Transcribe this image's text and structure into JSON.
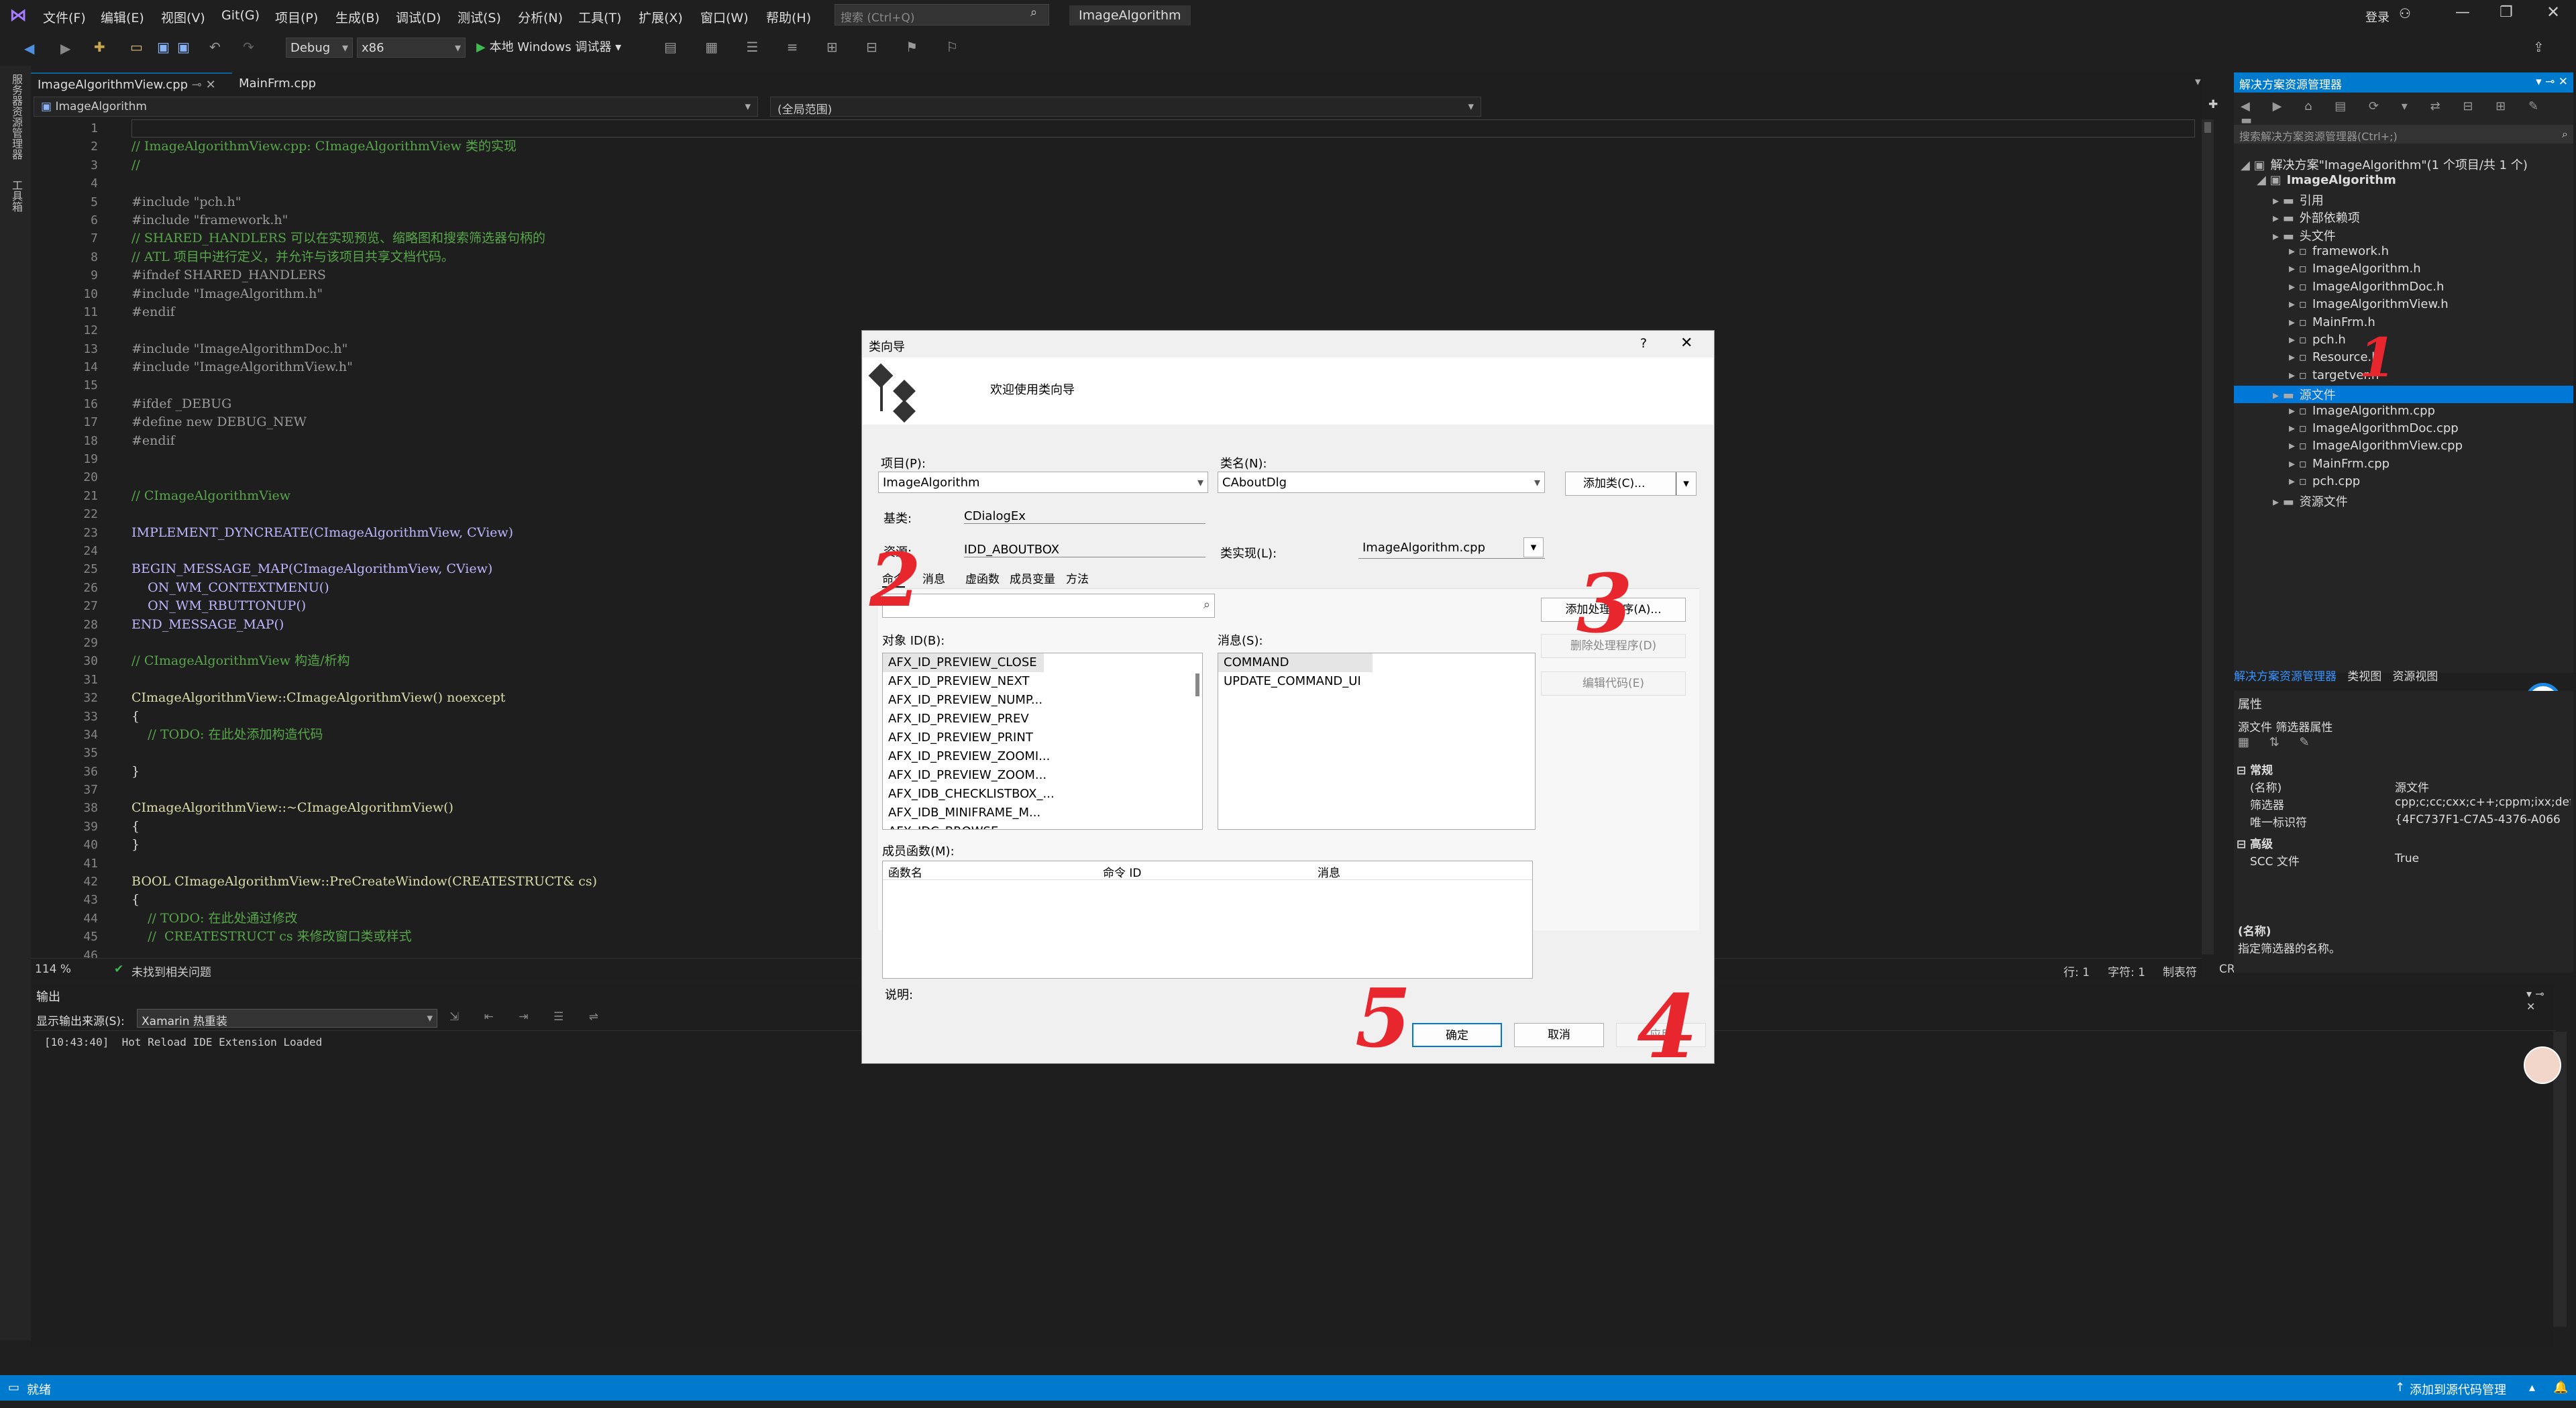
{
  "menu": [
    "文件(F)",
    "编辑(E)",
    "视图(V)",
    "Git(G)",
    "项目(P)",
    "生成(B)",
    "调试(D)",
    "测试(S)",
    "分析(N)",
    "工具(T)",
    "扩展(X)",
    "窗口(W)",
    "帮助(H)"
  ],
  "search": {
    "placeholder": "搜索 (Ctrl+Q)"
  },
  "app_title": "ImageAlgorithm",
  "login": "登录",
  "toolbar": {
    "config": "Debug",
    "platform": "x86",
    "run": "本地 Windows 调试器"
  },
  "left_tabs": [
    "服务器资源管理器",
    "工具箱"
  ],
  "editor": {
    "tabs": [
      "ImageAlgorithmView.cpp",
      "MainFrm.cpp"
    ],
    "nav_project": "ImageAlgorithm",
    "nav_scope": "(全局范围)",
    "line_numbers": [
      "1",
      "2",
      "3",
      "4",
      "5",
      "6",
      "7",
      "8",
      "9",
      "10",
      "11",
      "12",
      "13",
      "14",
      "15",
      "16",
      "17",
      "18",
      "19",
      "20",
      "21",
      "22",
      "23",
      "24",
      "25",
      "26",
      "27",
      "28",
      "29",
      "30",
      "31",
      "32",
      "33",
      "34",
      "35",
      "36",
      "37",
      "38",
      "39",
      "40",
      "41",
      "42",
      "43",
      "44",
      "45",
      "46"
    ],
    "code": [
      "",
      "// ImageAlgorithmView.cpp: CImageAlgorithmView 类的实现",
      "//",
      "",
      "#include \"pch.h\"",
      "#include \"framework.h\"",
      "// SHARED_HANDLERS 可以在实现预览、缩略图和搜索筛选器句柄的",
      "// ATL 项目中进行定义，并允许与该项目共享文档代码。",
      "#ifndef SHARED_HANDLERS",
      "#include \"ImageAlgorithm.h\"",
      "#endif",
      "",
      "#include \"ImageAlgorithmDoc.h\"",
      "#include \"ImageAlgorithmView.h\"",
      "",
      "#ifdef _DEBUG",
      "#define new DEBUG_NEW",
      "#endif",
      "",
      "",
      "// CImageAlgorithmView",
      "",
      "IMPLEMENT_DYNCREATE(CImageAlgorithmView, CView)",
      "",
      "BEGIN_MESSAGE_MAP(CImageAlgorithmView, CView)",
      "    ON_WM_CONTEXTMENU()",
      "    ON_WM_RBUTTONUP()",
      "END_MESSAGE_MAP()",
      "",
      "// CImageAlgorithmView 构造/析构",
      "",
      "CImageAlgorithmView::CImageAlgorithmView() noexcept",
      "{",
      "    // TODO: 在此处添加构造代码",
      "",
      "}",
      "",
      "CImageAlgorithmView::~CImageAlgorithmView()",
      "{",
      "}",
      "",
      "BOOL CImageAlgorithmView::PreCreateWindow(CREATESTRUCT& cs)",
      "{",
      "    // TODO: 在此处通过修改",
      "    //  CREATESTRUCT cs 来修改窗口类或样式",
      ""
    ],
    "zoom": "114 %",
    "issues": "未找到相关问题",
    "pos_line": "行: 1",
    "pos_char": "字符: 1",
    "tab_mode": "制表符",
    "eol": "CRLF"
  },
  "output": {
    "title": "输出",
    "source_label": "显示输出来源(S):",
    "source_value": "Xamarin 热重装",
    "log": "[10:43:40]  Hot Reload IDE Extension Loaded"
  },
  "solution": {
    "title": "解决方案资源管理器",
    "search_placeholder": "搜索解决方案资源管理器(Ctrl+;)",
    "items": [
      {
        "label": "解决方案\"ImageAlgorithm\"(1 个项目/共 1 个)",
        "level": 0
      },
      {
        "label": "ImageAlgorithm",
        "level": 1,
        "bold": true
      },
      {
        "label": "引用",
        "level": 2
      },
      {
        "label": "外部依赖项",
        "level": 2
      },
      {
        "label": "头文件",
        "level": 2
      },
      {
        "label": "framework.h",
        "level": 3
      },
      {
        "label": "ImageAlgorithm.h",
        "level": 3
      },
      {
        "label": "ImageAlgorithmDoc.h",
        "level": 3
      },
      {
        "label": "ImageAlgorithmView.h",
        "level": 3
      },
      {
        "label": "MainFrm.h",
        "level": 3
      },
      {
        "label": "pch.h",
        "level": 3
      },
      {
        "label": "Resource.h",
        "level": 3
      },
      {
        "label": "targetver.h",
        "level": 3
      },
      {
        "label": "源文件",
        "level": 2,
        "selected": true
      },
      {
        "label": "ImageAlgorithm.cpp",
        "level": 3
      },
      {
        "label": "ImageAlgorithmDoc.cpp",
        "level": 3
      },
      {
        "label": "ImageAlgorithmView.cpp",
        "level": 3
      },
      {
        "label": "MainFrm.cpp",
        "level": 3
      },
      {
        "label": "pch.cpp",
        "level": 3
      },
      {
        "label": "资源文件",
        "level": 2
      }
    ],
    "bottom_tabs": [
      "解决方案资源管理器",
      "类视图",
      "资源视图"
    ]
  },
  "properties": {
    "title": "属性",
    "subject": "源文件 筛选器属性",
    "cat_general": "常规",
    "rows": [
      [
        "(名称)",
        "源文件"
      ],
      [
        "筛选器",
        "cpp;c;cc;cxx;c++;cppm;ixx;def;"
      ],
      [
        "唯一标识符",
        "{4FC737F1-C7A5-4376-A066"
      ]
    ],
    "cat_adv": "高级",
    "adv_rows": [
      [
        "SCC 文件",
        "True"
      ]
    ],
    "desc_title": "(名称)",
    "desc_text": "指定筛选器的名称。"
  },
  "status": {
    "ready": "就绪",
    "source_control": "添加到源代码管理"
  },
  "dialog": {
    "title": "类向导",
    "help": "?",
    "welcome": "欢迎使用类向导",
    "project_label": "项目(P):",
    "project_value": "ImageAlgorithm",
    "classname_label": "类名(N):",
    "classname_value": "CAboutDlg",
    "add_class": "添加类(C)...",
    "base_label": "基类:",
    "base_value": "CDialogEx",
    "resource_label": "资源:",
    "resource_value": "IDD_ABOUTBOX",
    "impl_label": "类实现(L):",
    "impl_value": "ImageAlgorithm.cpp",
    "tabs": [
      "命令",
      "消息",
      "虚函数",
      "成员变量",
      "方法"
    ],
    "add_handler": "添加处理程序(A)...",
    "delete_handler": "删除处理程序(D)",
    "edit_code": "编辑代码(E)",
    "objid_label": "对象 ID(B):",
    "objids": [
      "AFX_ID_PREVIEW_CLOSE",
      "AFX_ID_PREVIEW_NEXT",
      "AFX_ID_PREVIEW_NUMP...",
      "AFX_ID_PREVIEW_PREV",
      "AFX_ID_PREVIEW_PRINT",
      "AFX_ID_PREVIEW_ZOOMI...",
      "AFX_ID_PREVIEW_ZOOM...",
      "AFX_IDB_CHECKLISTBOX_...",
      "AFX_IDB_MINIFRAME_M...",
      "AFX_IDC_BROWSE"
    ],
    "msg_label": "消息(S):",
    "messages": [
      "COMMAND",
      "UPDATE_COMMAND_UI"
    ],
    "member_label": "成员函数(M):",
    "member_cols": [
      "函数名",
      "命令 ID",
      "消息"
    ],
    "desc_label": "说明:",
    "ok": "确定",
    "cancel": "取消",
    "apply": "应用",
    "annotations": [
      "2",
      "3",
      "5",
      "4",
      "1"
    ]
  },
  "colors": {
    "accent": "#007acc",
    "selection": "#0078d7",
    "annotation": "#e8262e"
  }
}
